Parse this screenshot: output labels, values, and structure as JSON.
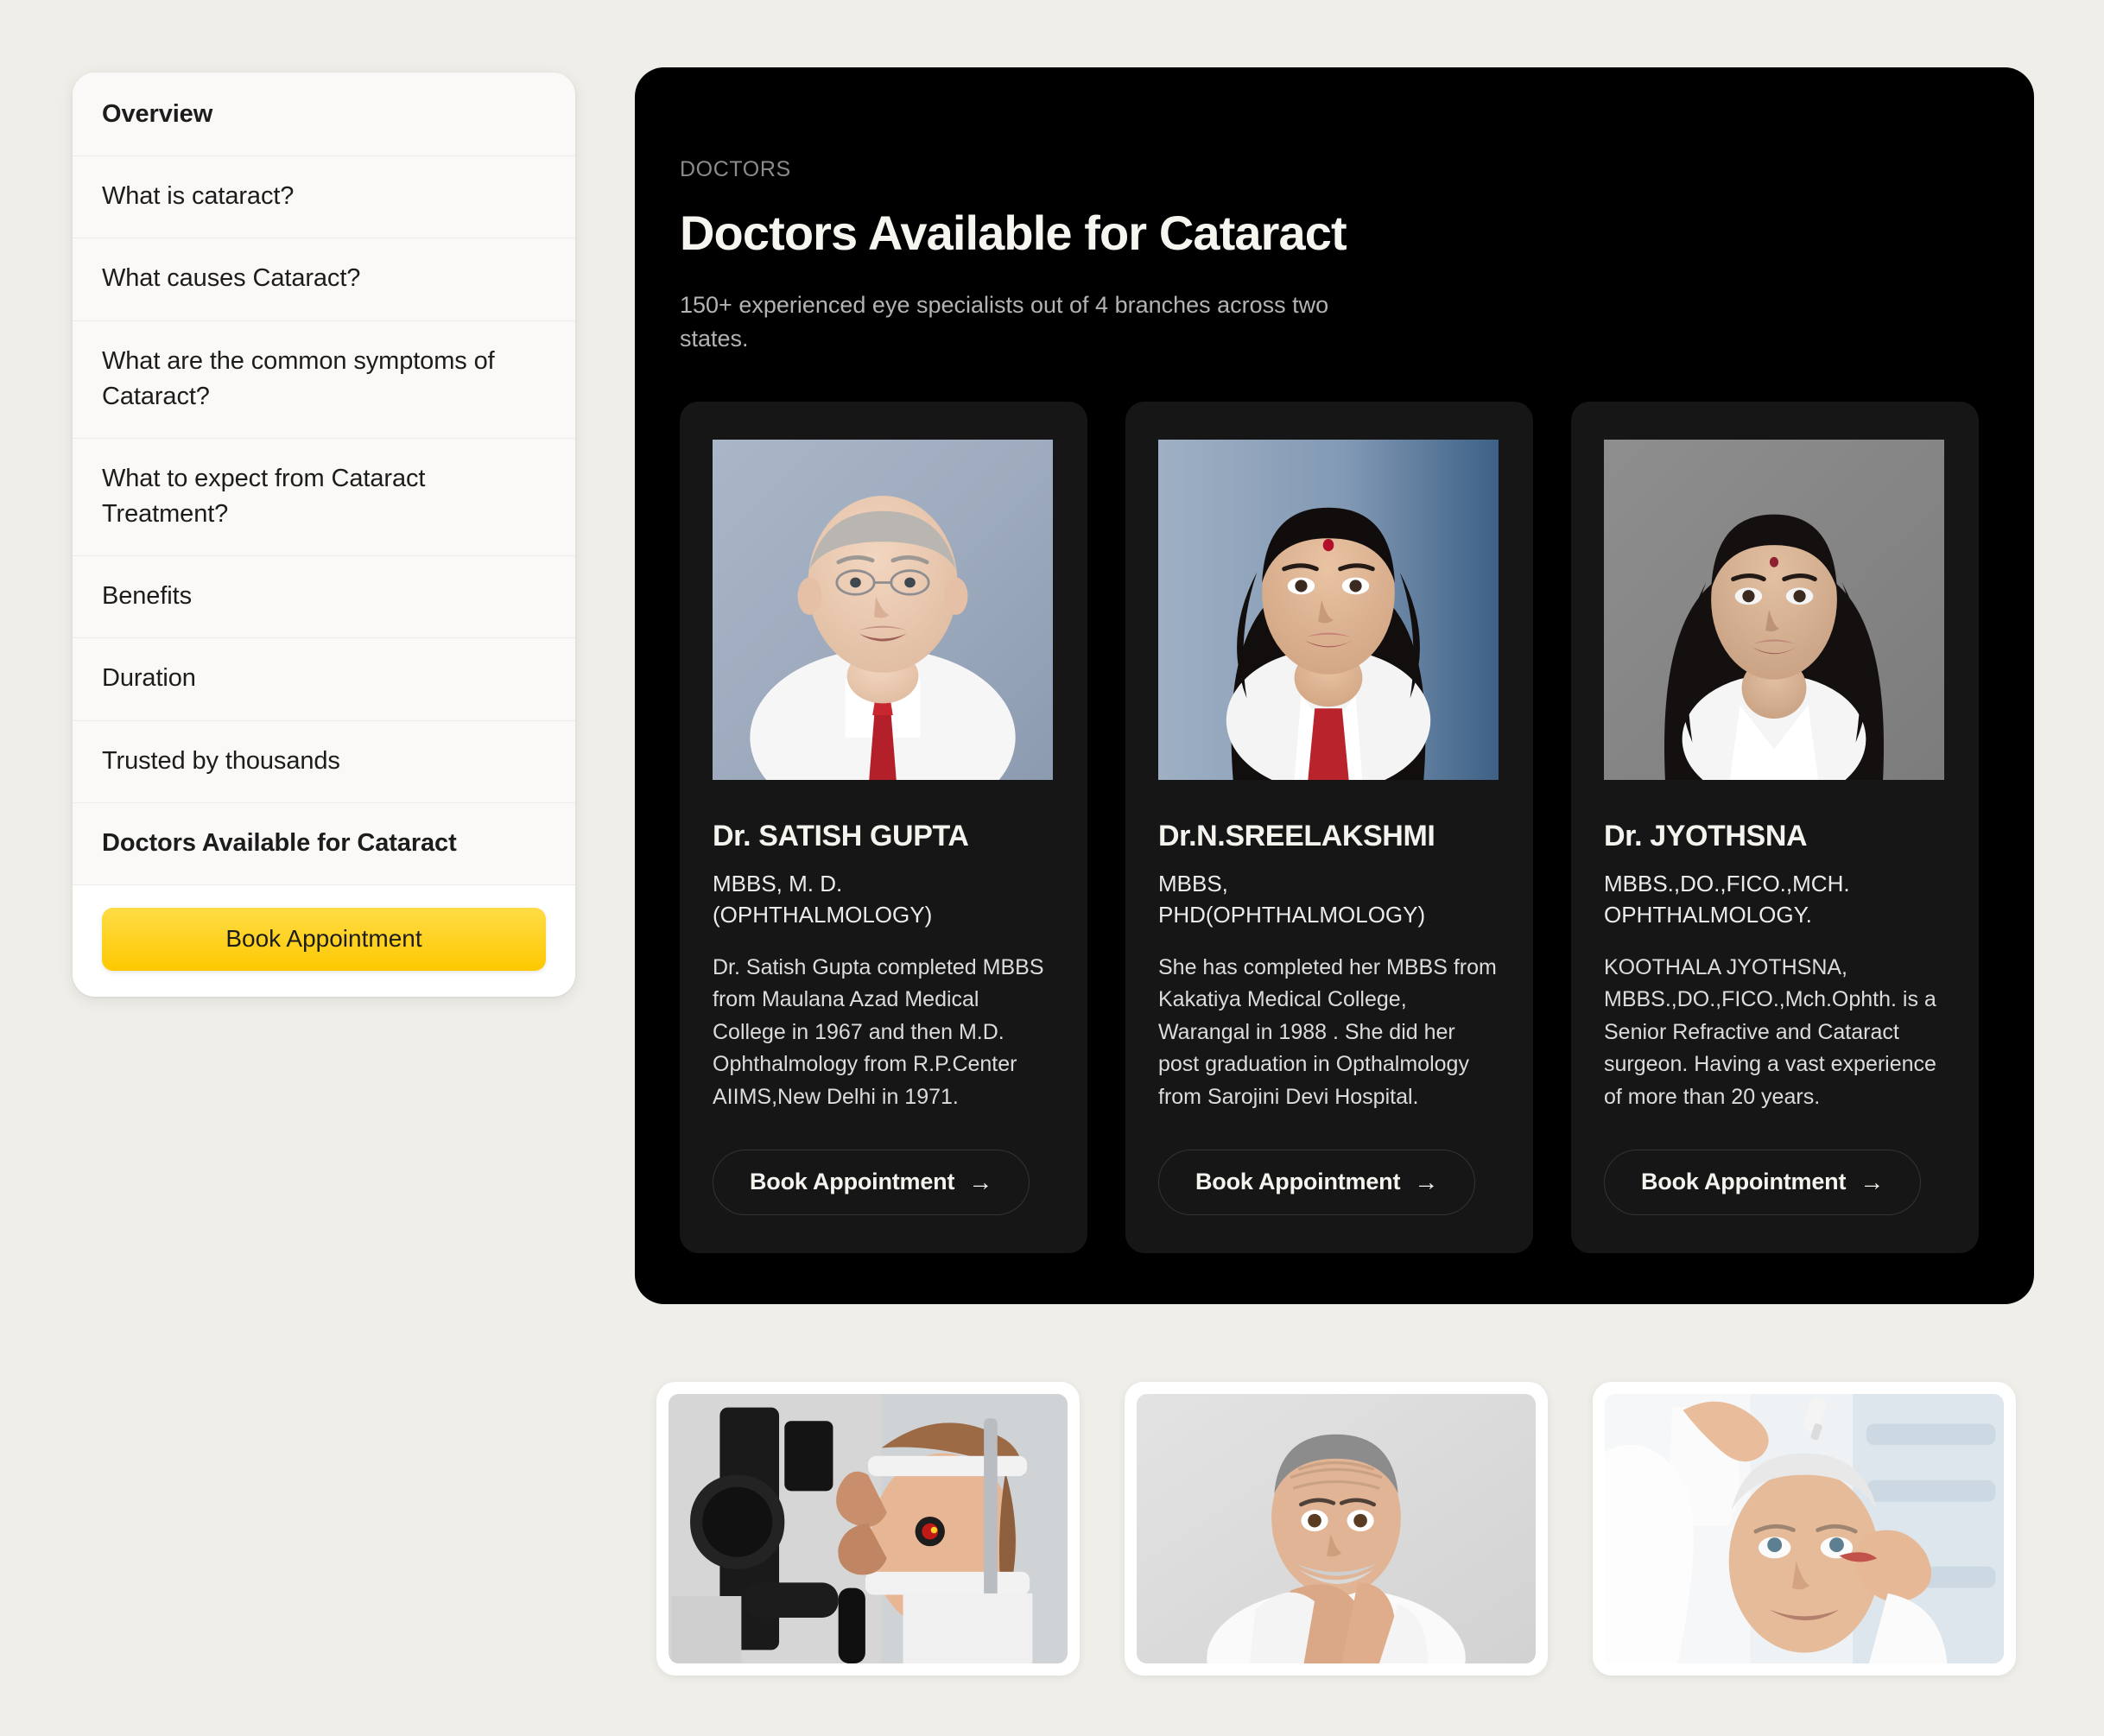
{
  "colors": {
    "page_background": "#efeee9",
    "sidebar_card": "#ffffff",
    "sidebar_list": "#faf9f7",
    "panel_background": "#000000",
    "doctor_card": "#161616",
    "accent_yellow": "#ffd427",
    "heading_text": "#f7f5f0",
    "muted_text": "#b3b3b3"
  },
  "sidebar": {
    "items": [
      {
        "label": "Overview",
        "bold": true
      },
      {
        "label": "What is cataract?",
        "bold": false
      },
      {
        "label": "What causes Cataract?",
        "bold": false
      },
      {
        "label": "What are the common symptoms of Cataract?",
        "bold": false
      },
      {
        "label": "What to expect from Cataract Treatment?",
        "bold": false
      },
      {
        "label": "Benefits",
        "bold": false
      },
      {
        "label": "Duration",
        "bold": false
      },
      {
        "label": "Trusted by thousands",
        "bold": false
      },
      {
        "label": "Doctors Available for Cataract",
        "bold": true
      }
    ],
    "cta_label": "Book Appointment"
  },
  "panel": {
    "eyebrow": "DOCTORS",
    "title": "Doctors Available for Cataract",
    "subtitle": "150+ experienced eye specialists out of 4 branches across two states.",
    "doctors": [
      {
        "name": "Dr. SATISH GUPTA",
        "qualification": "MBBS, M. D. (OPHTHALMOLOGY)",
        "bio": "Dr. Satish Gupta completed MBBS from Maulana Azad Medical College in 1967 and then M.D. Ophthalmology from R.P.Center AIIMS,New Delhi in 1971.",
        "cta_label": "Book Appointment",
        "photo_alt": "portrait-dr-satish-gupta"
      },
      {
        "name": "Dr.N.SREELAKSHMI",
        "qualification": "MBBS, PHD(OPHTHALMOLOGY)",
        "bio": "She has completed her MBBS from Kakatiya Medical College, Warangal in 1988 . She did her post graduation in Opthalmology from Sarojini Devi Hospital.",
        "cta_label": "Book Appointment",
        "photo_alt": "portrait-dr-n-sreelakshmi"
      },
      {
        "name": "Dr. JYOTHSNA",
        "qualification": "MBBS.,DO.,FICO.,MCH. OPHTHALMOLOGY.",
        "bio": "KOOTHALA JYOTHSNA, MBBS.,DO.,FICO.,Mch.Ophth. is a Senior Refractive and Cataract surgeon. Having a vast experience of more than 20 years.",
        "cta_label": "Book Appointment",
        "photo_alt": "portrait-dr-jyothsna"
      }
    ],
    "cta_arrow": "→"
  },
  "gallery": {
    "thumbnails": [
      {
        "alt": "slit-lamp-eye-examination-photo"
      },
      {
        "alt": "older-man-concerned-about-vision-photo"
      },
      {
        "alt": "doctor-applying-eye-drops-photo"
      }
    ]
  }
}
